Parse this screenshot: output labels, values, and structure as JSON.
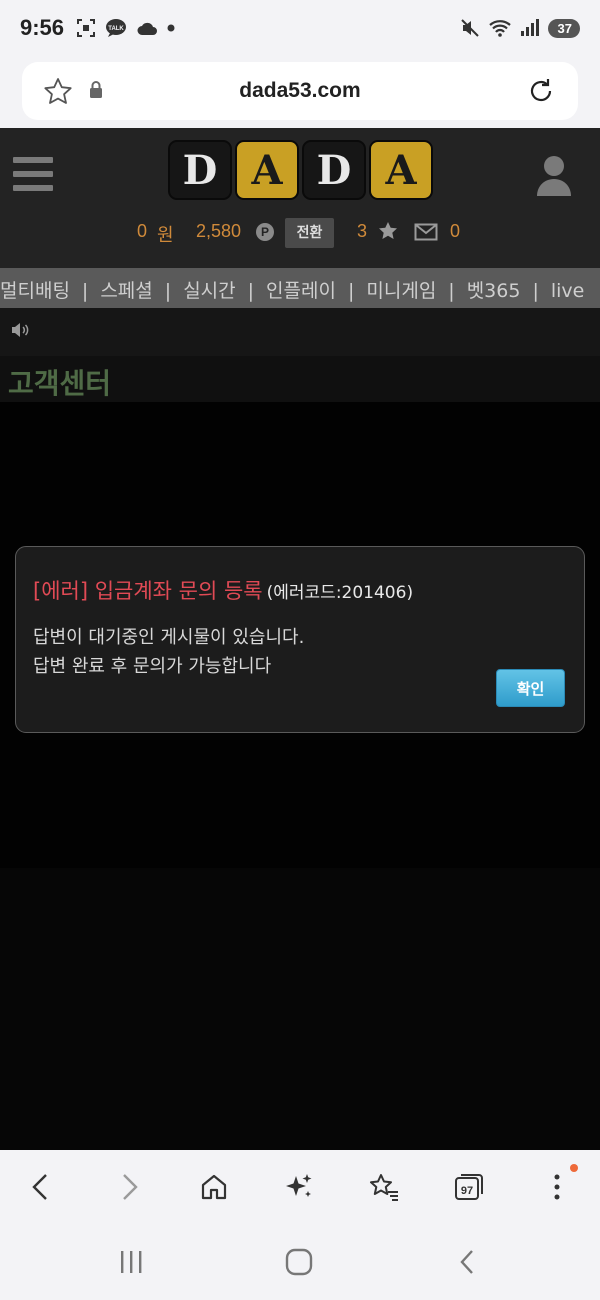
{
  "status_bar": {
    "time": "9:56",
    "battery": "37"
  },
  "browser": {
    "url": "dada53.com",
    "tabs_count": "97"
  },
  "site": {
    "logo_letters": [
      "D",
      "A",
      "D",
      "A"
    ],
    "money_amount": "0",
    "money_unit": "원",
    "points": "2,580",
    "points_badge": "P",
    "convert_label": "전환",
    "star_count": "3",
    "mail_count": "0",
    "nav_items": [
      "멀티배팅",
      "스페셜",
      "실시간",
      "인플레이",
      "미니게임",
      "벳365",
      "live"
    ],
    "nav_separator": "|",
    "page_title": "고객센터"
  },
  "dialog": {
    "title": "[에러] 입금계좌 문의 등록",
    "code": "(에러코드:201406)",
    "message_line1": "답변이 대기중인 게시물이 있습니다.",
    "message_line2": "답변 완료 후 문의가 가능합니다",
    "confirm_label": "확인"
  },
  "colors": {
    "accent_gold": "#c9a024",
    "error_red": "#e14a55",
    "confirm_blue": "#3ba8d5",
    "orange_text": "#d08a3a"
  }
}
